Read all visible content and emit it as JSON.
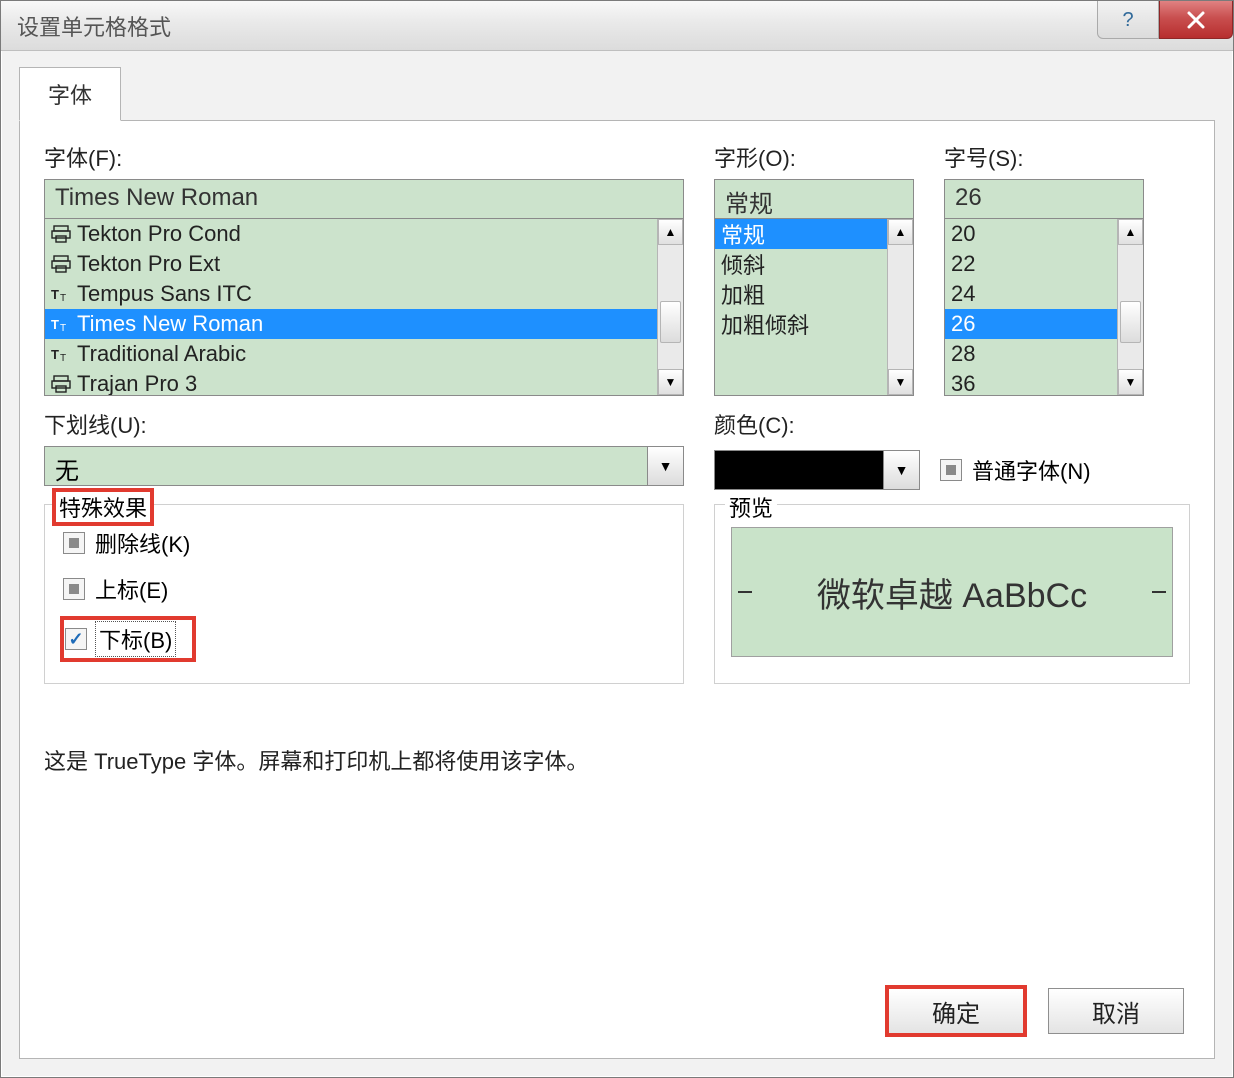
{
  "window": {
    "title": "设置单元格格式"
  },
  "tab": {
    "label": "字体"
  },
  "font": {
    "label": "字体(F):",
    "value": "Times New Roman",
    "items": [
      {
        "icon": "printer",
        "name": "Tekton Pro Cond"
      },
      {
        "icon": "printer",
        "name": "Tekton Pro Ext"
      },
      {
        "icon": "tt",
        "name": "Tempus Sans ITC"
      },
      {
        "icon": "tt",
        "name": "Times New Roman",
        "selected": true
      },
      {
        "icon": "tt",
        "name": "Traditional Arabic"
      },
      {
        "icon": "printer",
        "name": "Trajan Pro 3"
      }
    ]
  },
  "style": {
    "label": "字形(O):",
    "value": "常规",
    "items": [
      {
        "name": "常规",
        "selected": true
      },
      {
        "name": "倾斜"
      },
      {
        "name": "加粗"
      },
      {
        "name": "加粗倾斜"
      }
    ]
  },
  "size": {
    "label": "字号(S):",
    "value": "26",
    "items": [
      {
        "name": "20"
      },
      {
        "name": "22"
      },
      {
        "name": "24"
      },
      {
        "name": "26",
        "selected": true
      },
      {
        "name": "28"
      },
      {
        "name": "36"
      }
    ]
  },
  "underline": {
    "label": "下划线(U):",
    "value": "无"
  },
  "color": {
    "label": "颜色(C):",
    "swatch": "#000000"
  },
  "normalFont": {
    "label": "普通字体(N)"
  },
  "effects": {
    "title": "特殊效果",
    "strikethrough": "删除线(K)",
    "superscript": "上标(E)",
    "subscript": "下标(B)"
  },
  "preview": {
    "title": "预览",
    "text": "微软卓越 AaBbCc"
  },
  "hint": "这是 TrueType 字体。屏幕和打印机上都将使用该字体。",
  "buttons": {
    "ok": "确定",
    "cancel": "取消"
  }
}
